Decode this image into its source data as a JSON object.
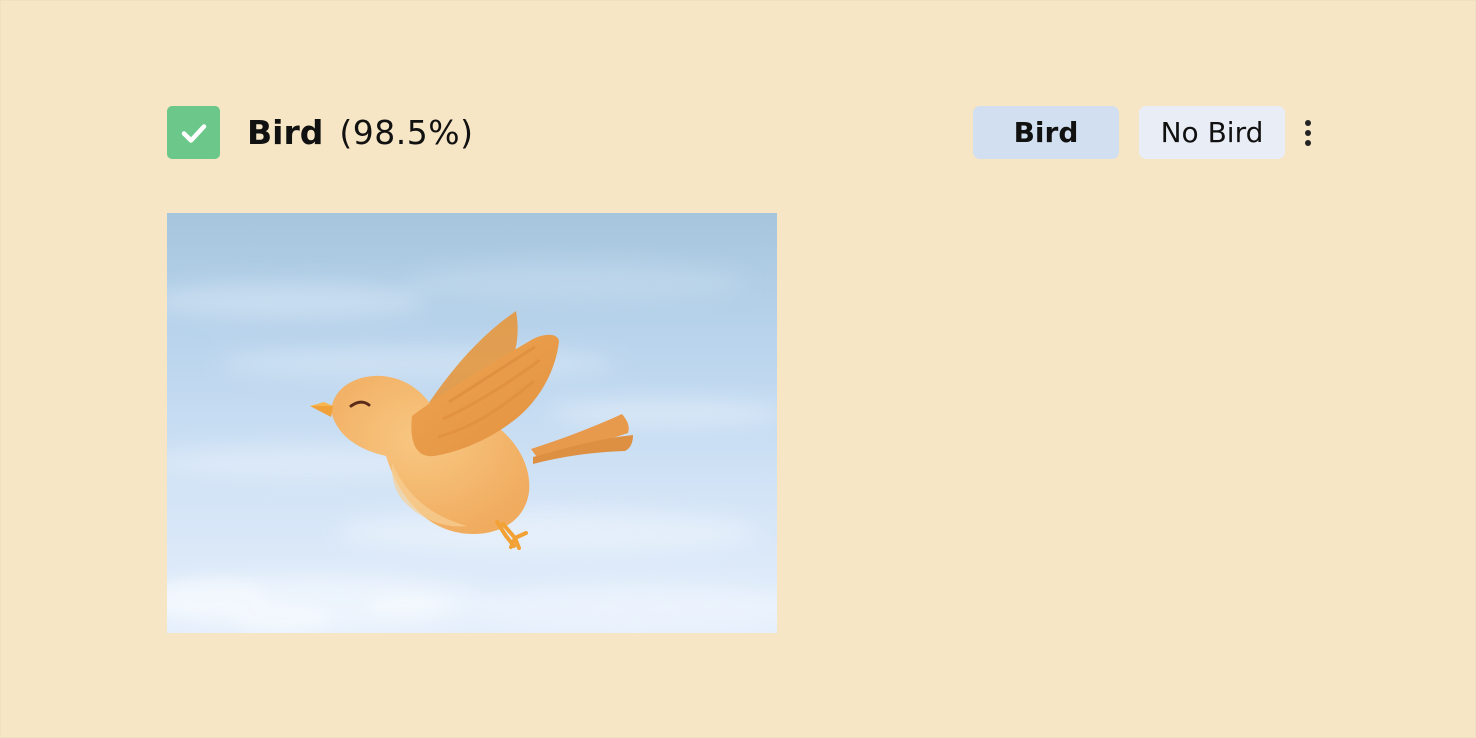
{
  "item": {
    "checked": true,
    "label": "Bird",
    "confidence": "(98.5%)",
    "image_alt": "bird-illustration"
  },
  "actions": {
    "bird_button": "Bird",
    "no_bird_button": "No Bird"
  },
  "colors": {
    "background": "#f6e6c6",
    "checkbox_green": "#6cc88a",
    "bird_button_bg": "#d2dff0",
    "no_bird_button_bg": "#e9edf5",
    "sky_top": "#a9c8e0",
    "bird_orange": "#f5b56c"
  },
  "icons": {
    "checkbox": "check-icon",
    "more": "more-vertical-icon"
  }
}
